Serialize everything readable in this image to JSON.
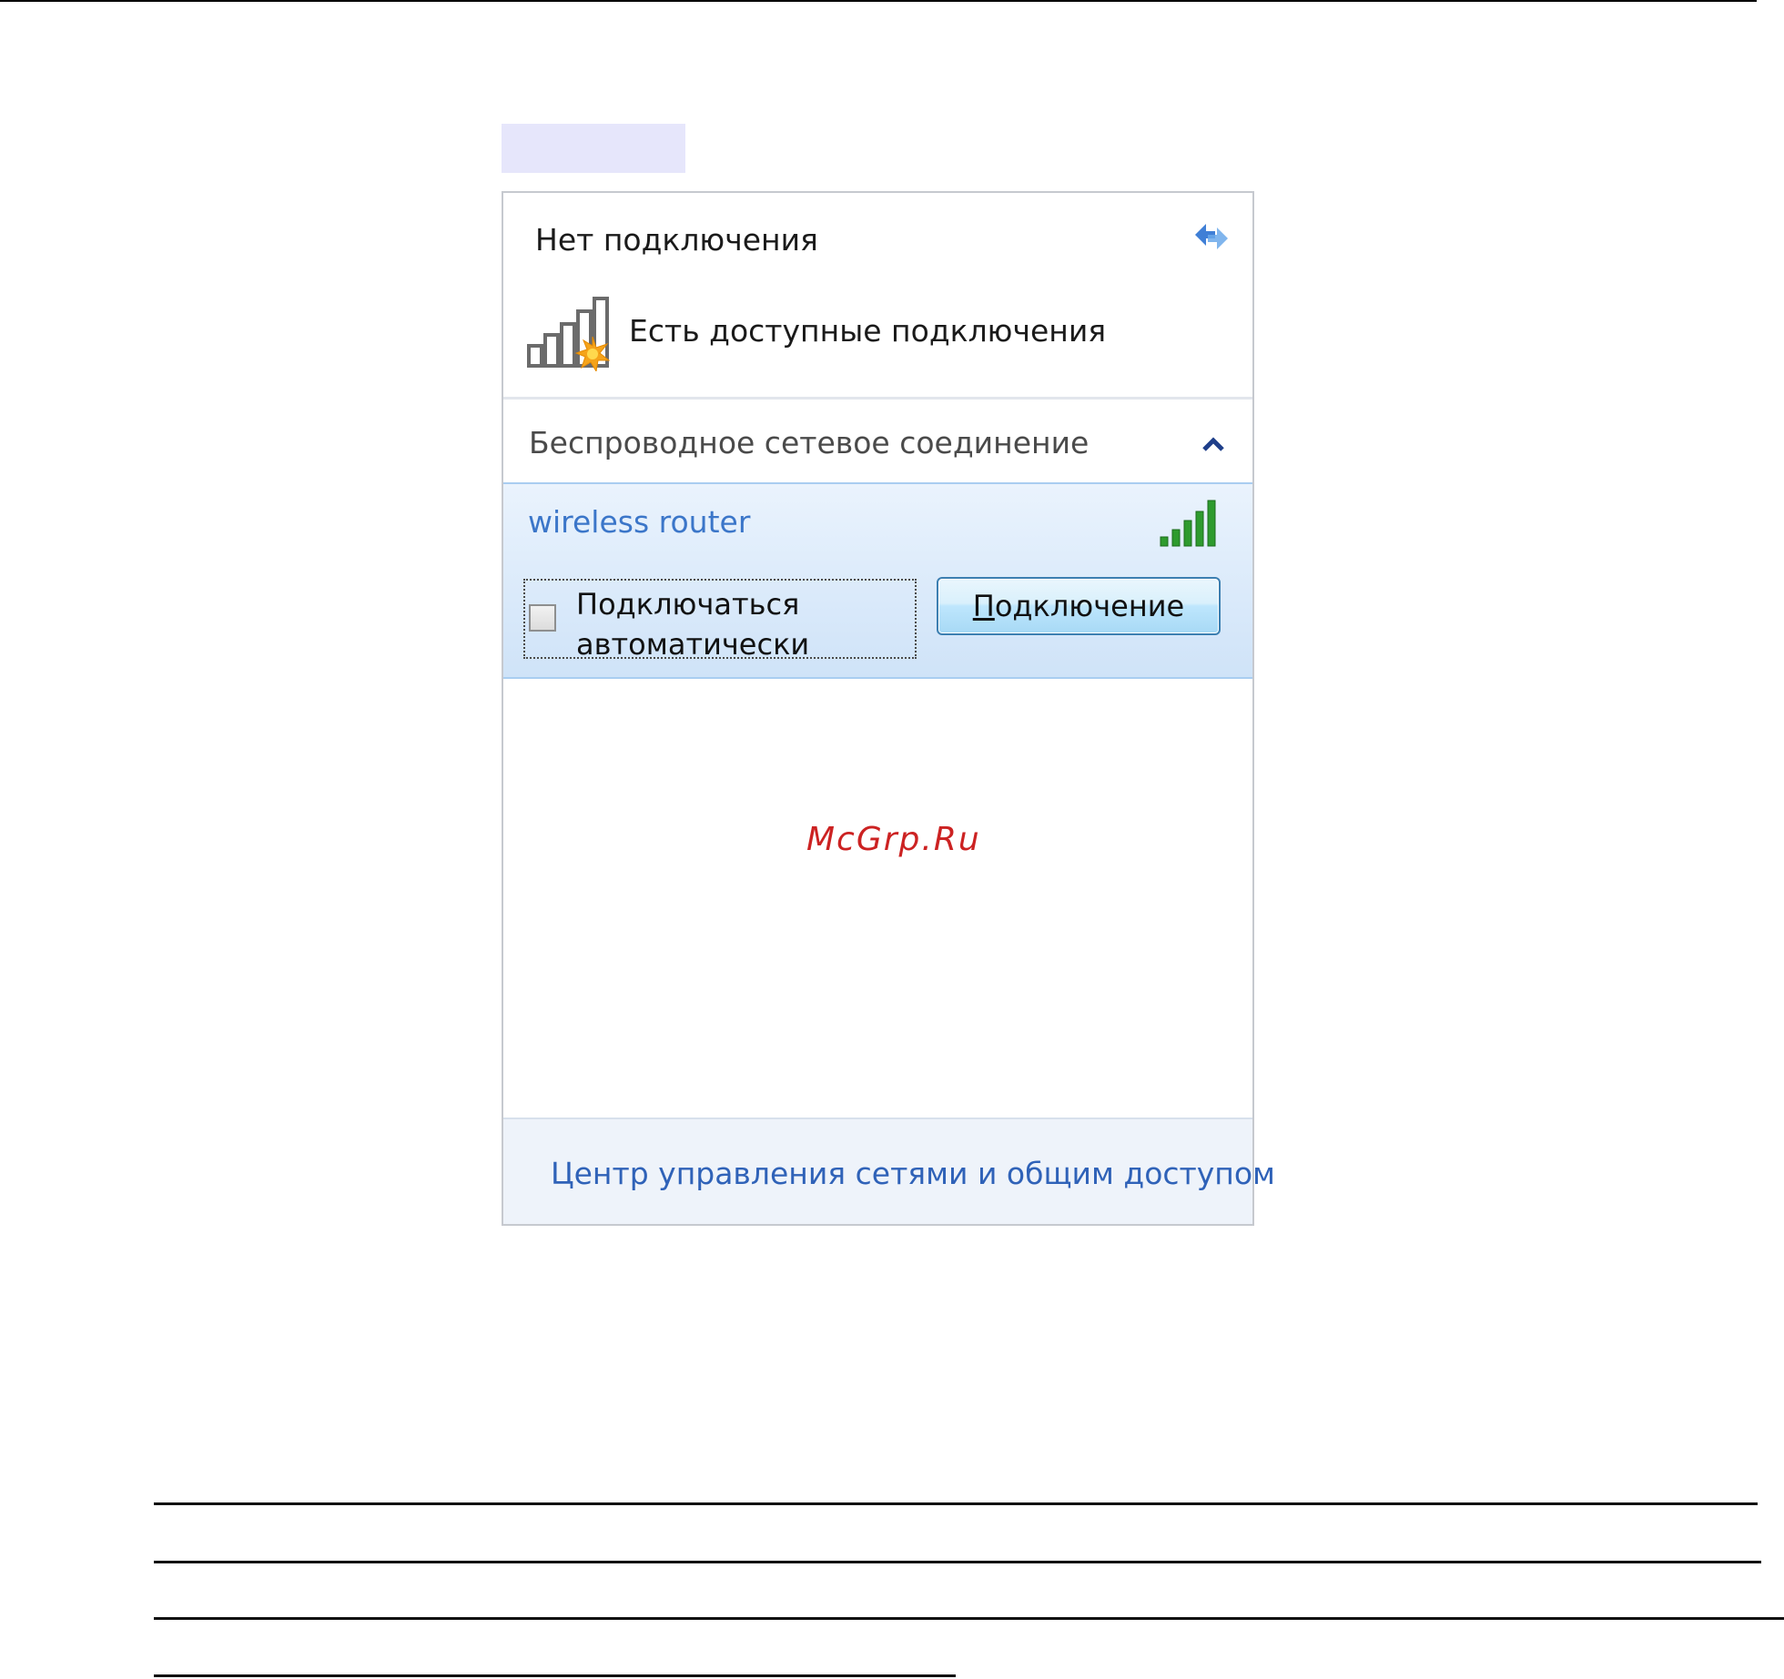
{
  "flyout": {
    "status_title": "Нет подключения",
    "available_text": "Есть доступные подключения",
    "section_title": "Беспроводное сетевое соединение",
    "network": {
      "name": "wireless router",
      "auto_connect_line1": "Подключаться",
      "auto_connect_line2": "автоматически",
      "auto_connect_checked": false,
      "connect_button_accesskey": "П",
      "connect_button_rest": "одключение",
      "signal_strength": "5/5"
    },
    "watermark": "McGrp.Ru",
    "footer_link": "Центр управления сетями и общим доступом"
  },
  "icons": {
    "refresh": "refresh-icon",
    "available_networks": "wireless-signal-star-icon",
    "collapse": "chevron-up-icon",
    "signal": "signal-bars-icon"
  },
  "colors": {
    "link": "#3b76c9",
    "watermark": "#cc2222",
    "selected_bg": "#d9ebfb",
    "signal": "#2e9b2e"
  }
}
